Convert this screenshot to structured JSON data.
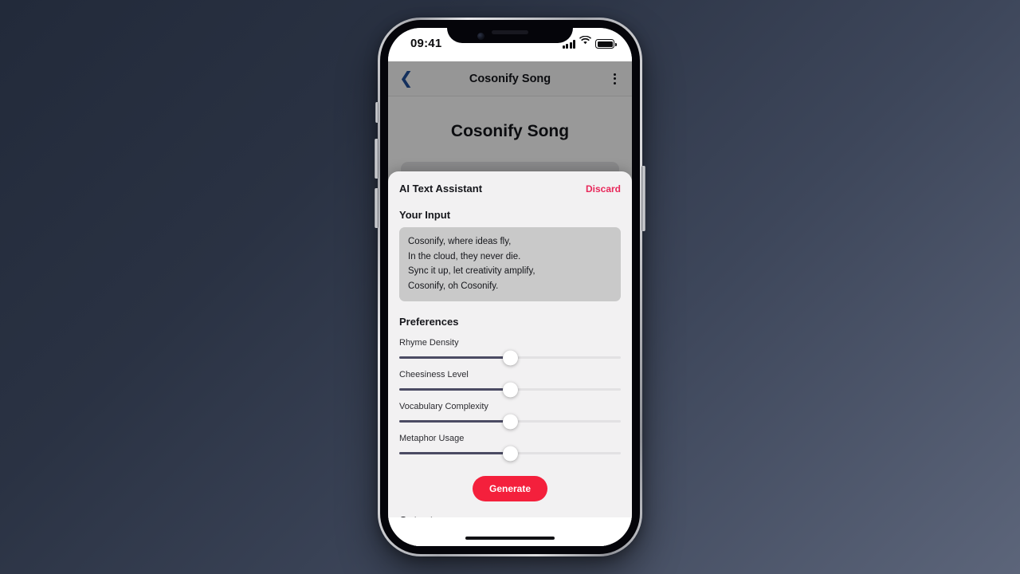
{
  "status_bar": {
    "time": "09:41",
    "signal_icon": "cellular-signal-icon",
    "wifi_icon": "wifi-icon",
    "battery_icon": "battery-icon"
  },
  "nav": {
    "back_icon": "chevron-left-icon",
    "title": "Cosonify Song",
    "menu_icon": "overflow-menu-icon"
  },
  "page": {
    "heading": "Cosonify Song",
    "lyrics": "Cosonify, where ideas fly,\nIn the cloud, they never die.\nSync it up, let creativity amplify,\nCosonify, oh Cosonify."
  },
  "sheet": {
    "title": "AI Text Assistant",
    "discard_label": "Discard",
    "input_section_label": "Your Input",
    "input_lines": [
      "Cosonify, where ideas fly,",
      "In the cloud, they never die.",
      "Sync it up, let creativity amplify,",
      "Cosonify, oh Cosonify."
    ],
    "preferences_label": "Preferences",
    "sliders": [
      {
        "label": "Rhyme Density",
        "value": 50
      },
      {
        "label": "Cheesiness Level",
        "value": 50
      },
      {
        "label": "Vocabulary Complexity",
        "value": 50
      },
      {
        "label": "Metaphor Usage",
        "value": 50
      }
    ],
    "generate_label": "Generate",
    "output_label": "Output",
    "output_value": ""
  },
  "colors": {
    "accent_red": "#f4203c",
    "discard_red": "#e8285a",
    "slider_fill": "#4b4b63",
    "slider_track": "#e2e1e3",
    "sheet_bg": "#f2f1f2",
    "input_bg": "#c9c9c9",
    "nav_link_blue": "#22509b"
  }
}
